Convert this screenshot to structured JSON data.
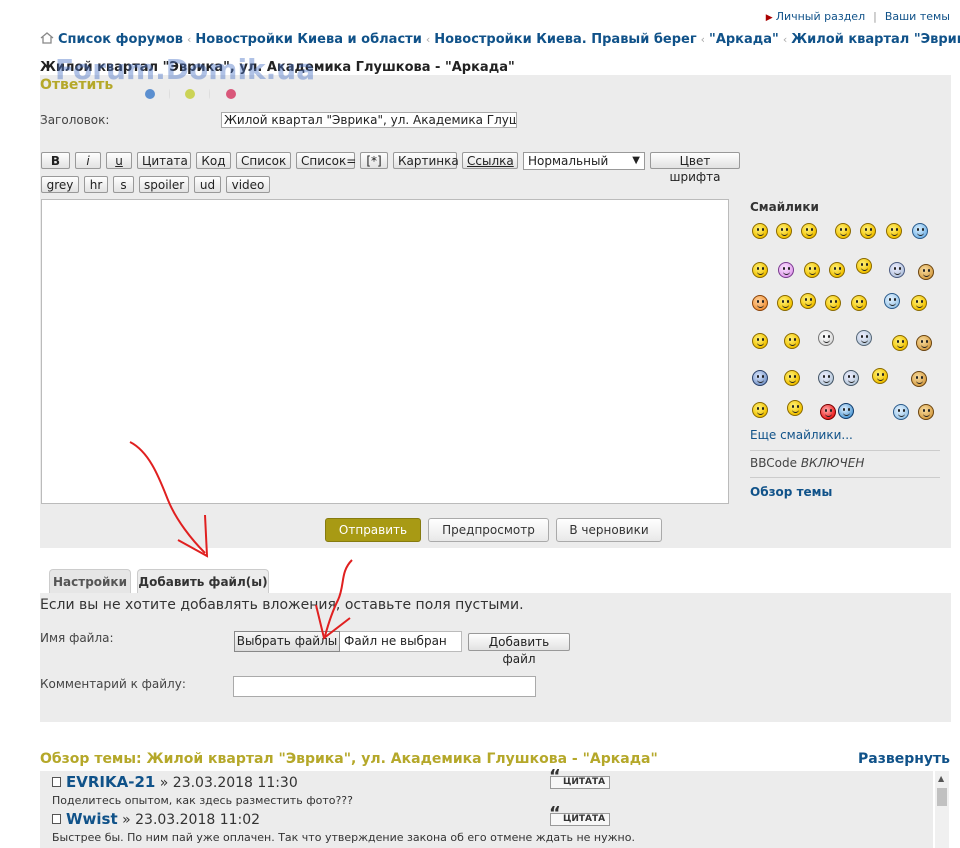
{
  "top_links": {
    "personal": "Личный раздел",
    "your_topics": "Ваши темы"
  },
  "breadcrumbs": [
    "Список форумов",
    "Новостройки Киева и области",
    "Новостройки Киева. Правый берег",
    "\"Аркада\"",
    "Жилой квартал \"Эврика\""
  ],
  "topic_title": "Жилой квартал \"Эврика\", ул. Академика Глушкова - \"Аркада\"",
  "watermark": "Forum.Domik.ua",
  "post_form": {
    "heading": "Ответить",
    "subject_label": "Заголовок:",
    "subject_value": "Жилой квартал \"Эврика\", ул. Академика Глушкова - \"Аркада\"",
    "bbcode_row1": [
      "B",
      "i",
      "u",
      "Цитата",
      "Код",
      "Список",
      "Список=",
      "[*]",
      "Картинка",
      "Ссылка"
    ],
    "font_size_select": "Нормальный",
    "font_color_button": "Цвет шрифта",
    "bbcode_row2": [
      "grey",
      "hr",
      "s",
      "spoiler",
      "ud",
      "video"
    ],
    "smilies_title": "Смайлики",
    "more_smilies": "Еще смайлики...",
    "bbcode_status_prefix": "BBCode",
    "bbcode_status": "ВКЛЮЧЕН",
    "topic_review_link": "Обзор темы",
    "submit": "Отправить",
    "preview": "Предпросмотр",
    "draft": "В черновики"
  },
  "tabs": {
    "options": "Настройки",
    "attach": "Добавить файл(ы)"
  },
  "attachments": {
    "note": "Если вы не хотите добавлять вложения, оставьте поля пустыми.",
    "filename_label": "Имя файла:",
    "choose_files": "Выбрать файлы",
    "no_file": "Файл не выбран",
    "add_file": "Добавить файл",
    "comment_label": "Комментарий к файлу:"
  },
  "review": {
    "title": "Обзор темы: Жилой квартал \"Эврика\", ул. Академика Глушкова - \"Аркада\"",
    "expand": "Развернуть",
    "quote_label": "ЦИТАТА",
    "posts": [
      {
        "author": "EVRIKA-21",
        "date": "» 23.03.2018 11:30",
        "text": "Поделитесь опытом, как здесь разместить фото???"
      },
      {
        "author": "Wwist",
        "date": "» 23.03.2018 11:02",
        "text": "Быстрее бы. По ним пай уже оплачен. Так что утверждение закона об его отмене ждать не нужно."
      }
    ]
  },
  "colors": {
    "accent": "#a89a14",
    "link": "#105289",
    "annotation_arrow": "#e02020"
  }
}
